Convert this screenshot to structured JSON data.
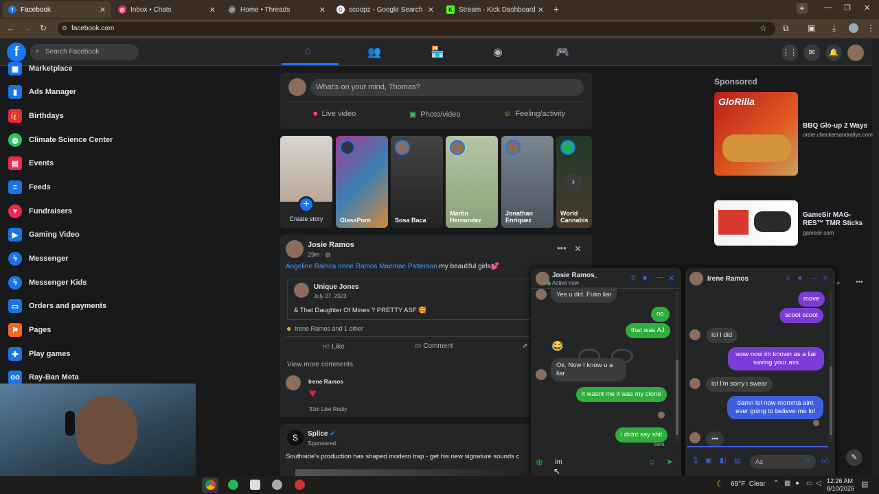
{
  "browser": {
    "tabs": [
      {
        "label": "Facebook",
        "icon": "facebook-icon",
        "color": "#1877f2",
        "active": true
      },
      {
        "label": "Inbox • Chats",
        "icon": "instagram-icon",
        "color": "#e1306c"
      },
      {
        "label": "Home • Threads",
        "icon": "threads-icon",
        "color": "#444"
      },
      {
        "label": "scoopz - Google Search",
        "icon": "google-icon",
        "color": "#4285f4"
      },
      {
        "label": "Stream - Kick Dashboard",
        "icon": "kick-icon",
        "color": "#53fc18"
      }
    ],
    "url": "facebook.com"
  },
  "header": {
    "search_placeholder": "Search Facebook"
  },
  "sidebar": {
    "items": [
      {
        "label": "Marketplace",
        "icon": "marketplace-icon",
        "color": "#1b74e4"
      },
      {
        "label": "Ads Manager",
        "icon": "chart-icon",
        "color": "#1b74e4"
      },
      {
        "label": "Birthdays",
        "icon": "gift-icon",
        "color": "#e42645"
      },
      {
        "label": "Climate Science Center",
        "icon": "globe-icon",
        "color": "#2ec255"
      },
      {
        "label": "Events",
        "icon": "calendar-icon",
        "color": "#f02849"
      },
      {
        "label": "Feeds",
        "icon": "feeds-icon",
        "color": "#1b74e4"
      },
      {
        "label": "Fundraisers",
        "icon": "heart-icon",
        "color": "#f02849"
      },
      {
        "label": "Gaming Video",
        "icon": "gaming-video-icon",
        "color": "#1b74e4"
      },
      {
        "label": "Messenger",
        "icon": "messenger-icon",
        "color": "#1b74e4"
      },
      {
        "label": "Messenger Kids",
        "icon": "messenger-kids-icon",
        "color": "#1b74e4"
      },
      {
        "label": "Orders and payments",
        "icon": "card-icon",
        "color": "#1b74e4"
      },
      {
        "label": "Pages",
        "icon": "flag-icon",
        "color": "#f26b21"
      },
      {
        "label": "Play games",
        "icon": "game-controller-icon",
        "color": "#1b74e4"
      },
      {
        "label": "Ray-Ban Meta",
        "icon": "glasses-icon",
        "color": "#1b74e4"
      }
    ]
  },
  "composer": {
    "placeholder": "What's on your mind, Thomas?",
    "live": "Live video",
    "photo": "Photo/video",
    "feeling": "Feeling/activity"
  },
  "stories": [
    {
      "name": "Create story"
    },
    {
      "name": "GlassPorn"
    },
    {
      "name": "Sosa Baca"
    },
    {
      "name": "Martin Hernandez"
    },
    {
      "name": "Jonathan Enriquez"
    },
    {
      "name": "World Cannabis"
    }
  ],
  "post": {
    "author": "Josie Ramos",
    "time": "29m",
    "text_tags": "Angeline Ramos Irene Ramos Maemae Patterson",
    "text": "my beautiful girls💕",
    "shared_author": "Unique Jones",
    "shared_date": "July 27, 2023",
    "shared_text": "& That Daughter Of Mines ? PRETTY ASF 🥰",
    "reactions": "Irene Ramos and 1 other",
    "like": "Like",
    "comment": "Comment",
    "view_more": "View more comments",
    "comment_author": "Irene Ramos",
    "comment_time": "31m",
    "comment_like": "Like",
    "comment_reply": "Reply"
  },
  "post2": {
    "author": "Splice",
    "sponsored": "Sponsored",
    "text": "Southside's production has shaped modern trap - get his new signature sounds c"
  },
  "sponsored": {
    "heading": "Sponsored",
    "ads": [
      {
        "title": "BBQ Glo-up 2 Ways",
        "domain": "order.checkersandrallys.com",
        "art": "GloRilla"
      },
      {
        "title": "GameSir MAG-RES™ TMR Sticks",
        "domain": "gamesir.com"
      }
    ]
  },
  "chat1": {
    "name": "Josie Ramos",
    "status": "Active now",
    "messages": [
      {
        "from": "them",
        "text": "Yes u did. Fukn liar"
      },
      {
        "from": "me",
        "text": "no"
      },
      {
        "from": "me",
        "text": "that was AJ"
      },
      {
        "from": "them",
        "text": "Ok. Now I know u a liar"
      },
      {
        "from": "me",
        "text": "it wasnt me it was my clone"
      },
      {
        "from": "me",
        "text": "i didnt say shit"
      }
    ],
    "sent": "Sent",
    "input": "im"
  },
  "chat2": {
    "name": "Irene Ramos",
    "messages": [
      {
        "from": "me",
        "text": "move"
      },
      {
        "from": "me",
        "text": "scoot scoot"
      },
      {
        "from": "them",
        "text": "lol I did"
      },
      {
        "from": "me",
        "text": "wow now im known as a liar saving your ass"
      },
      {
        "from": "them",
        "text": "lol I'm sorry i swear"
      },
      {
        "from": "me",
        "text": "damn lol now momma aint ever going to believe me lol"
      }
    ],
    "input_placeholder": "Aa"
  },
  "taskbar": {
    "weather": "69°F  Clear",
    "time": "12:26 AM",
    "date": "8/10/2025"
  }
}
